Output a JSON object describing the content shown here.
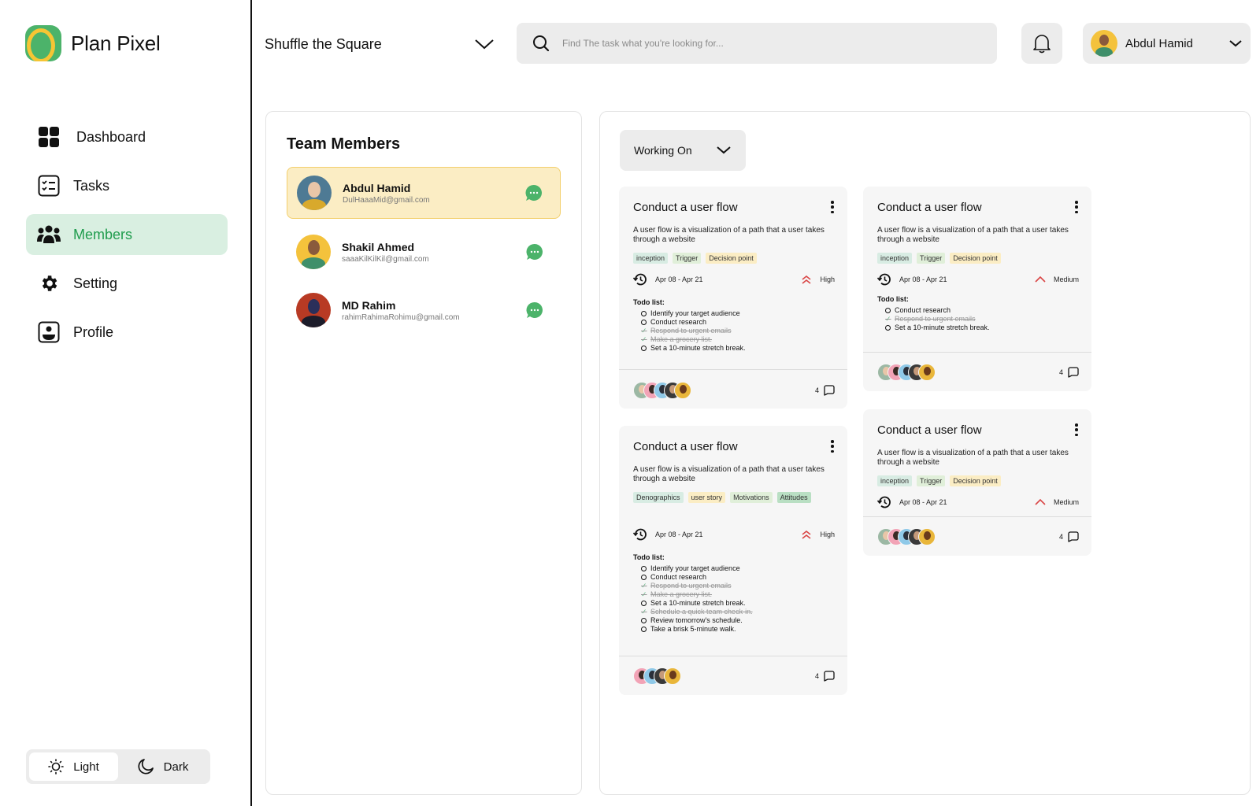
{
  "app": {
    "name": "Plan Pixel"
  },
  "sidebar": {
    "items": [
      {
        "label": "Dashboard",
        "icon": "grid-icon",
        "active": false
      },
      {
        "label": "Tasks",
        "icon": "checklist-icon",
        "active": false
      },
      {
        "label": "Members",
        "icon": "members-icon",
        "active": true
      },
      {
        "label": "Setting",
        "icon": "gear-icon",
        "active": false
      },
      {
        "label": "Profile",
        "icon": "profile-icon",
        "active": false
      }
    ],
    "theme": {
      "light_label": "Light",
      "dark_label": "Dark",
      "selected": "Light"
    }
  },
  "header": {
    "project": "Shuffle the Square",
    "search_placeholder": "Find The task what you're looking for...",
    "user_name": "Abdul Hamid"
  },
  "team": {
    "title": "Team Members",
    "members": [
      {
        "name": "Abdul Hamid",
        "email": "DulHaaaMid@gmail.com",
        "selected": true
      },
      {
        "name": "Shakil Ahmed",
        "email": "saaaKilKilKil@gmail.com",
        "selected": false
      },
      {
        "name": "MD Rahim",
        "email": "rahimRahimaRohimu@gmail.com",
        "selected": false
      }
    ]
  },
  "board": {
    "status_filter": "Working On",
    "todo_title": "Todo list:",
    "cards": [
      {
        "title": "Conduct a user flow",
        "description": "A user flow is a visualization of a path that a user takes through a website",
        "tags": [
          {
            "label": "inception",
            "color": "#d8ece3"
          },
          {
            "label": "Trigger",
            "color": "#e0efd9"
          },
          {
            "label": "Decision point",
            "color": "#fbedc4"
          }
        ],
        "date": "Apr 08 - Apr 21",
        "priority": "High",
        "todos": [
          {
            "text": "Identify your target audience",
            "done": false
          },
          {
            "text": "Conduct research",
            "done": false
          },
          {
            "text": "Respond to urgent emails",
            "done": true
          },
          {
            "text": "Make a grocery list.",
            "done": true
          },
          {
            "text": "Set a 10-minute stretch break.",
            "done": false
          }
        ],
        "assignee_count": 5,
        "comments": "4"
      },
      {
        "title": "Conduct a user flow",
        "description": "A user flow is a visualization of a path that a user takes through a website",
        "tags": [
          {
            "label": "inception",
            "color": "#d8ece3"
          },
          {
            "label": "Trigger",
            "color": "#e0efd9"
          },
          {
            "label": "Decision point",
            "color": "#fbedc4"
          }
        ],
        "date": "Apr 08 - Apr 21",
        "priority": "Medium",
        "todos": [
          {
            "text": "Conduct research",
            "done": false
          },
          {
            "text": "Respond to urgent emails",
            "done": true
          },
          {
            "text": "Set a 10-minute stretch break.",
            "done": false
          }
        ],
        "assignee_count": 5,
        "comments": "4"
      },
      {
        "title": "Conduct a user flow",
        "description": "A user flow is a visualization of a path that a user takes through a website",
        "tags": [
          {
            "label": "Denographics",
            "color": "#d8ece3"
          },
          {
            "label": "user story",
            "color": "#fbedc4"
          },
          {
            "label": "Motivations",
            "color": "#e0efd9"
          },
          {
            "label": "Attitudes",
            "color": "#b9dfc3"
          }
        ],
        "date": "Apr 08 - Apr 21",
        "priority": "High",
        "todos": [
          {
            "text": "Identify your target audience",
            "done": false
          },
          {
            "text": "Conduct research",
            "done": false
          },
          {
            "text": "Respond to urgent emails",
            "done": true
          },
          {
            "text": "Make a grocery list.",
            "done": true
          },
          {
            "text": "Set a 10-minute stretch break.",
            "done": false
          },
          {
            "text": "Schedule a quick team check-in.",
            "done": true
          },
          {
            "text": "Review tomorrow's schedule.",
            "done": false
          },
          {
            "text": "Take a brisk 5-minute walk.",
            "done": false
          }
        ],
        "assignee_count": 4,
        "comments": "4"
      },
      {
        "title": "Conduct a user flow",
        "description": "A user flow is a visualization of a path that a user takes through a website",
        "tags": [
          {
            "label": "inception",
            "color": "#d8ece3"
          },
          {
            "label": "Trigger",
            "color": "#e0efd9"
          },
          {
            "label": "Decision point",
            "color": "#fbedc4"
          }
        ],
        "date": "Apr 08 - Apr 21",
        "priority": "Medium",
        "todos": [],
        "assignee_count": 5,
        "comments": "4"
      }
    ]
  },
  "colors": {
    "accent_green": "#1f9c4d",
    "active_bg": "#d9efe1",
    "selected_member_bg": "#fbedc4",
    "priority_red": "#d94545",
    "chat_green": "#4cb36a"
  }
}
